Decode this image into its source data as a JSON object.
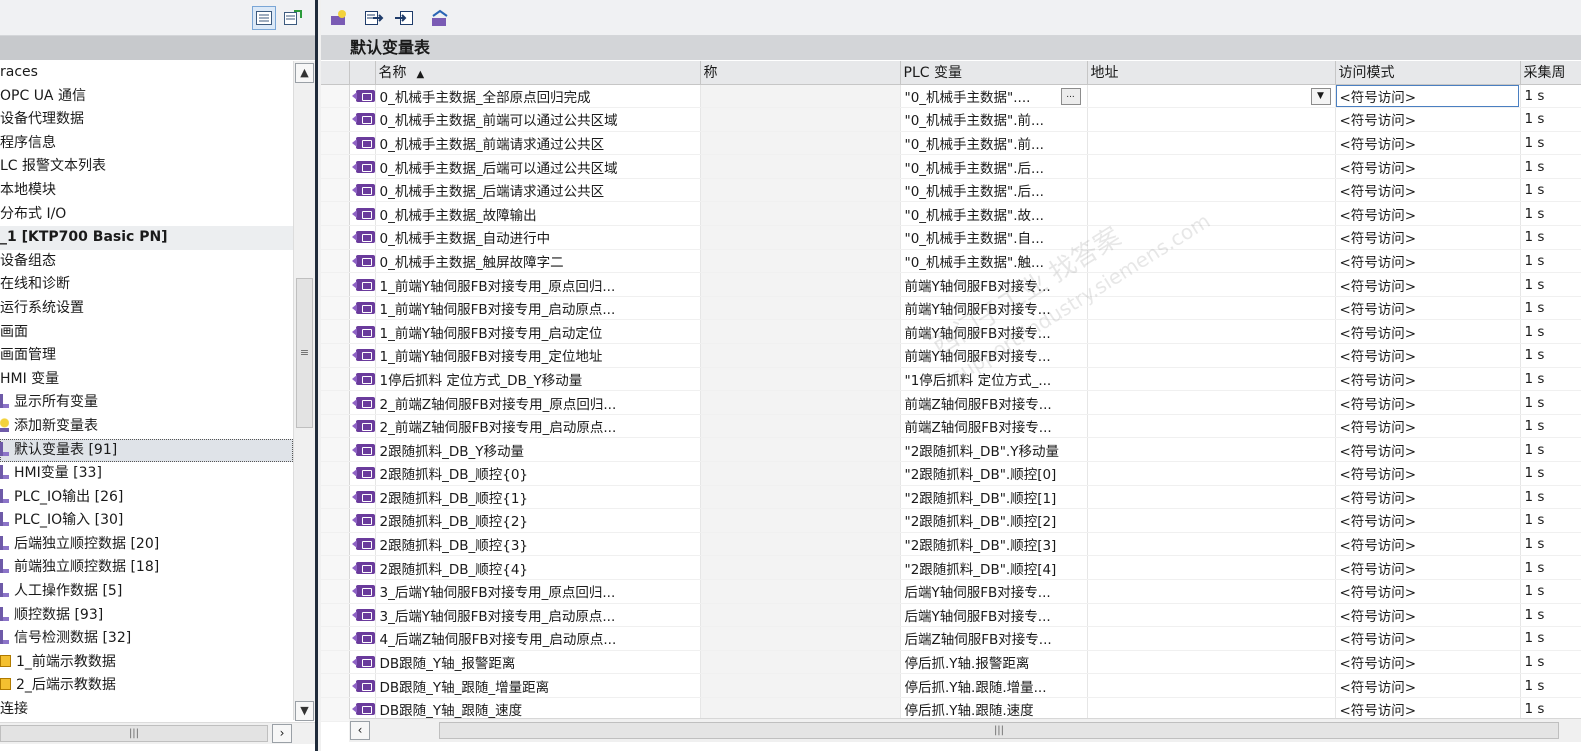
{
  "left_panel": {
    "tree": [
      {
        "label": "races",
        "style": "plain"
      },
      {
        "label": "OPC UA 通信",
        "style": "plain"
      },
      {
        "label": "设备代理数据",
        "style": "plain"
      },
      {
        "label": "程序信息",
        "style": "plain"
      },
      {
        "label": "LC 报警文本列表",
        "style": "plain"
      },
      {
        "label": "本地模块",
        "style": "plain"
      },
      {
        "label": "分布式 I/O",
        "style": "plain"
      },
      {
        "label": "_1 [KTP700 Basic PN]",
        "style": "bold"
      },
      {
        "label": "设备组态",
        "style": "plain"
      },
      {
        "label": "在线和诊断",
        "style": "plain"
      },
      {
        "label": "运行系统设置",
        "style": "plain"
      },
      {
        "label": "画面",
        "style": "plain"
      },
      {
        "label": "画面管理",
        "style": "plain"
      },
      {
        "label": "HMI 变量",
        "style": "plain"
      },
      {
        "label": "显示所有变量",
        "style": "tbl"
      },
      {
        "label": "添加新变量表",
        "style": "add"
      },
      {
        "label": "默认变量表 [91]",
        "style": "selected"
      },
      {
        "label": "HMI变量 [33]",
        "style": "tbl"
      },
      {
        "label": "PLC_IO输出 [26]",
        "style": "tbl"
      },
      {
        "label": "PLC_IO输入 [30]",
        "style": "tbl"
      },
      {
        "label": "后端独立顺控数据 [20]",
        "style": "tbl"
      },
      {
        "label": "前端独立顺控数据 [18]",
        "style": "tbl"
      },
      {
        "label": "人工操作数据 [5]",
        "style": "tbl"
      },
      {
        "label": "顺控数据 [93]",
        "style": "tbl"
      },
      {
        "label": "信号检测数据 [32]",
        "style": "tbl"
      },
      {
        "label": "1_前端示教数据",
        "style": "db"
      },
      {
        "label": "2_后端示教数据",
        "style": "db"
      },
      {
        "label": "连接",
        "style": "plain"
      }
    ]
  },
  "editor": {
    "title": "默认变量表",
    "columns": {
      "name": "名称",
      "display_name": "称",
      "plc_tag": "PLC 变量",
      "address": "地址",
      "access_mode": "访问模式",
      "acq_cycle": "采集周"
    },
    "sort_indicator": "▲",
    "rows": [
      {
        "name": "0_机械手主数据_全部原点回归完成",
        "plc": "\"0_机械手主数据\"....",
        "access": "<符号访问>",
        "cycle": "1 s"
      },
      {
        "name": "0_机械手主数据_前端可以通过公共区域",
        "plc": "\"0_机械手主数据\".前...",
        "access": "<符号访问>",
        "cycle": "1 s"
      },
      {
        "name": "0_机械手主数据_前端请求通过公共区",
        "plc": "\"0_机械手主数据\".前...",
        "access": "<符号访问>",
        "cycle": "1 s"
      },
      {
        "name": "0_机械手主数据_后端可以通过公共区域",
        "plc": "\"0_机械手主数据\".后...",
        "access": "<符号访问>",
        "cycle": "1 s"
      },
      {
        "name": "0_机械手主数据_后端请求通过公共区",
        "plc": "\"0_机械手主数据\".后...",
        "access": "<符号访问>",
        "cycle": "1 s"
      },
      {
        "name": "0_机械手主数据_故障输出",
        "plc": "\"0_机械手主数据\".故...",
        "access": "<符号访问>",
        "cycle": "1 s"
      },
      {
        "name": "0_机械手主数据_自动进行中",
        "plc": "\"0_机械手主数据\".自...",
        "access": "<符号访问>",
        "cycle": "1 s"
      },
      {
        "name": "0_机械手主数据_触屏故障字二",
        "plc": "\"0_机械手主数据\".触...",
        "access": "<符号访问>",
        "cycle": "1 s"
      },
      {
        "name": "1_前端Y轴伺服FB对接专用_原点回归...",
        "plc": "前端Y轴伺服FB对接专...",
        "access": "<符号访问>",
        "cycle": "1 s"
      },
      {
        "name": "1_前端Y轴伺服FB对接专用_启动原点...",
        "plc": "前端Y轴伺服FB对接专...",
        "access": "<符号访问>",
        "cycle": "1 s"
      },
      {
        "name": "1_前端Y轴伺服FB对接专用_启动定位",
        "plc": "前端Y轴伺服FB对接专...",
        "access": "<符号访问>",
        "cycle": "1 s"
      },
      {
        "name": "1_前端Y轴伺服FB对接专用_定位地址",
        "plc": "前端Y轴伺服FB对接专...",
        "access": "<符号访问>",
        "cycle": "1 s"
      },
      {
        "name": "1停后抓料 定位方式_DB_Y移动量",
        "plc": "\"1停后抓料 定位方式_...",
        "access": "<符号访问>",
        "cycle": "1 s"
      },
      {
        "name": "2_前端Z轴伺服FB对接专用_原点回归...",
        "plc": "前端Z轴伺服FB对接专...",
        "access": "<符号访问>",
        "cycle": "1 s"
      },
      {
        "name": "2_前端Z轴伺服FB对接专用_启动原点...",
        "plc": "前端Z轴伺服FB对接专...",
        "access": "<符号访问>",
        "cycle": "1 s"
      },
      {
        "name": "2跟随抓料_DB_Y移动量",
        "plc": "\"2跟随抓料_DB\".Y移动量",
        "access": "<符号访问>",
        "cycle": "1 s"
      },
      {
        "name": "2跟随抓料_DB_顺控{0}",
        "plc": "\"2跟随抓料_DB\".顺控[0]",
        "access": "<符号访问>",
        "cycle": "1 s"
      },
      {
        "name": "2跟随抓料_DB_顺控{1}",
        "plc": "\"2跟随抓料_DB\".顺控[1]",
        "access": "<符号访问>",
        "cycle": "1 s"
      },
      {
        "name": "2跟随抓料_DB_顺控{2}",
        "plc": "\"2跟随抓料_DB\".顺控[2]",
        "access": "<符号访问>",
        "cycle": "1 s"
      },
      {
        "name": "2跟随抓料_DB_顺控{3}",
        "plc": "\"2跟随抓料_DB\".顺控[3]",
        "access": "<符号访问>",
        "cycle": "1 s"
      },
      {
        "name": "2跟随抓料_DB_顺控{4}",
        "plc": "\"2跟随抓料_DB\".顺控[4]",
        "access": "<符号访问>",
        "cycle": "1 s"
      },
      {
        "name": "3_后端Y轴伺服FB对接专用_原点回归...",
        "plc": "后端Y轴伺服FB对接专...",
        "access": "<符号访问>",
        "cycle": "1 s"
      },
      {
        "name": "3_后端Y轴伺服FB对接专用_启动原点...",
        "plc": "后端Y轴伺服FB对接专...",
        "access": "<符号访问>",
        "cycle": "1 s"
      },
      {
        "name": "4_后端Z轴伺服FB对接专用_启动原点...",
        "plc": "后端Z轴伺服FB对接专...",
        "access": "<符号访问>",
        "cycle": "1 s"
      },
      {
        "name": "DB跟随_Y轴_报警距离",
        "plc": "停后抓.Y轴.报警距离",
        "access": "<符号访问>",
        "cycle": "1 s"
      },
      {
        "name": "DB跟随_Y轴_跟随_增量距离",
        "plc": "停后抓.Y轴.跟随.增量...",
        "access": "<符号访问>",
        "cycle": "1 s"
      },
      {
        "name": "DB跟随_Y轴_跟随_速度",
        "plc": "停后抓.Y轴.跟随.速度",
        "access": "<符号访问>",
        "cycle": "1 s"
      }
    ]
  },
  "watermark": {
    "line1": "西门子工业 找答案",
    "line2": "support.industry.siemens.com"
  }
}
